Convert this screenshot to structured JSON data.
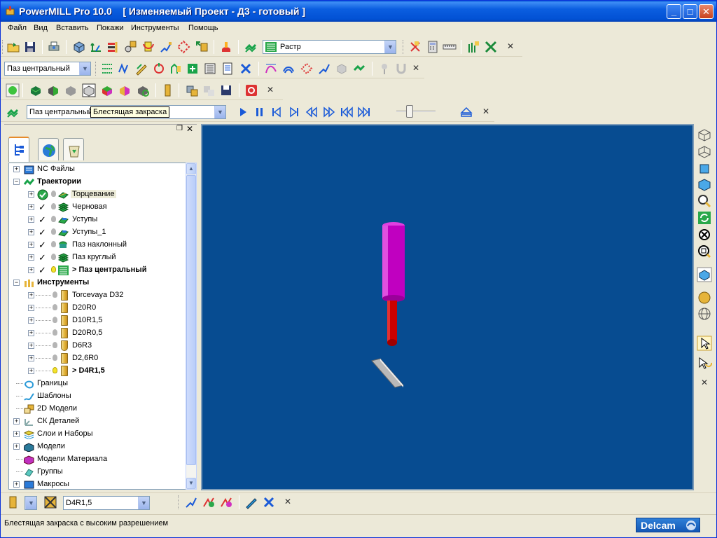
{
  "window": {
    "title": "PowerMILL Pro 10.0    [ Изменяемый Проект - Д3 - готовый ]",
    "minimize": "_",
    "maximize": "□",
    "close": "✕"
  },
  "menu": [
    "Файл",
    "Вид",
    "Вставить",
    "Покажи",
    "Инструменты",
    "Помощь"
  ],
  "toolbar1": {
    "render_combo": "Растр"
  },
  "toolbar2": {
    "toolpath_combo": "Паз центральный"
  },
  "toolbar4": {
    "toolpath_combo": "Паз центральный"
  },
  "tooltip": "Блестящая закраска",
  "tree": {
    "items": [
      {
        "label": "NC Файлы",
        "bold": false
      },
      {
        "label": "Траектории",
        "bold": true
      },
      {
        "label": "Торцевание",
        "bold": false
      },
      {
        "label": "Черновая",
        "bold": false
      },
      {
        "label": "Уступы",
        "bold": false
      },
      {
        "label": "Уступы_1",
        "bold": false
      },
      {
        "label": "Паз наклонный",
        "bold": false
      },
      {
        "label": "Паз круглый",
        "bold": false
      },
      {
        "label": "> Паз центральный",
        "bold": true
      },
      {
        "label": "Инструменты",
        "bold": true
      },
      {
        "label": "Torcevaya D32",
        "bold": false
      },
      {
        "label": "D20R0",
        "bold": false
      },
      {
        "label": "D10R1,5",
        "bold": false
      },
      {
        "label": "D20R0,5",
        "bold": false
      },
      {
        "label": "D6R3",
        "bold": false
      },
      {
        "label": "D2,6R0",
        "bold": false
      },
      {
        "label": "> D4R1,5",
        "bold": true
      },
      {
        "label": "Границы",
        "bold": false
      },
      {
        "label": "Шаблоны",
        "bold": false
      },
      {
        "label": "2D Модели",
        "bold": false
      },
      {
        "label": "СК Деталей",
        "bold": false
      },
      {
        "label": "Слои и Наборы",
        "bold": false
      },
      {
        "label": "Модели",
        "bold": false
      },
      {
        "label": "Модели Материала",
        "bold": false
      },
      {
        "label": "Группы",
        "bold": false
      },
      {
        "label": "Макросы",
        "bold": false
      }
    ]
  },
  "bottombar": {
    "tool_combo": "D4R1,5"
  },
  "status": {
    "message": "Блестящая закраска с высоким разрешением",
    "brand": "Delcam"
  },
  "colors": {
    "viewport_bg": "#074c91",
    "holder": "#c000c0",
    "tool_shank": "#cc0000",
    "titlebar": "#0251d4"
  }
}
